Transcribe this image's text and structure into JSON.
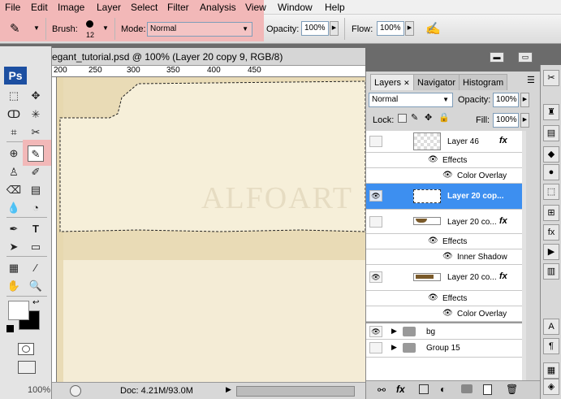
{
  "menu": {
    "items": [
      "File",
      "Edit",
      "Image",
      "Layer",
      "Select",
      "Filter",
      "Analysis",
      "View",
      "Window",
      "Help"
    ]
  },
  "options": {
    "brush_label": "Brush:",
    "brush_size": "12",
    "mode_label": "Mode:",
    "mode_value": "Normal",
    "opacity_label": "Opacity:",
    "opacity_value": "100%",
    "flow_label": "Flow:",
    "flow_value": "100%"
  },
  "app_logo": "Ps",
  "document": {
    "title": "egant_tutorial.psd @ 100% (Layer 20 copy 9, RGB/8)",
    "ruler_ticks": [
      "200",
      "250",
      "300",
      "350",
      "400",
      "450"
    ],
    "watermark": "ALFOART",
    "status_zoom": "100%",
    "status_doc": "Doc: 4.21M/93.0M"
  },
  "layers_panel": {
    "tabs": [
      "Layers",
      "Navigator",
      "Histogram"
    ],
    "blend_mode": "Normal",
    "opacity_label": "Opacity:",
    "opacity_value": "100%",
    "lock_label": "Lock:",
    "fill_label": "Fill:",
    "fill_value": "100%",
    "rows": [
      {
        "name": "Layer 46",
        "type": "layer",
        "fx": "fx",
        "visible": false,
        "selected": false
      },
      {
        "name": "Effects",
        "type": "effects"
      },
      {
        "name": "Color Overlay",
        "type": "effect"
      },
      {
        "name": "Layer 20 cop...",
        "type": "layer",
        "fx": "",
        "visible": true,
        "selected": true
      },
      {
        "name": "Layer 20 co...",
        "type": "layer",
        "fx": "fx",
        "visible": false,
        "selected": false
      },
      {
        "name": "Effects",
        "type": "effects"
      },
      {
        "name": "Inner Shadow",
        "type": "effect"
      },
      {
        "name": "Layer 20 co...",
        "type": "layer",
        "fx": "fx",
        "visible": true,
        "selected": false
      },
      {
        "name": "Effects",
        "type": "effects"
      },
      {
        "name": "Color Overlay",
        "type": "effect"
      },
      {
        "name": "bg",
        "type": "group",
        "visible": true
      },
      {
        "name": "Group 15",
        "type": "group",
        "visible": false
      }
    ],
    "bottom_fx": "fx"
  },
  "colors": {
    "highlight": "#f2b8b8",
    "selected_row": "#3d8ff0",
    "canvas": "#f4ecd6"
  }
}
